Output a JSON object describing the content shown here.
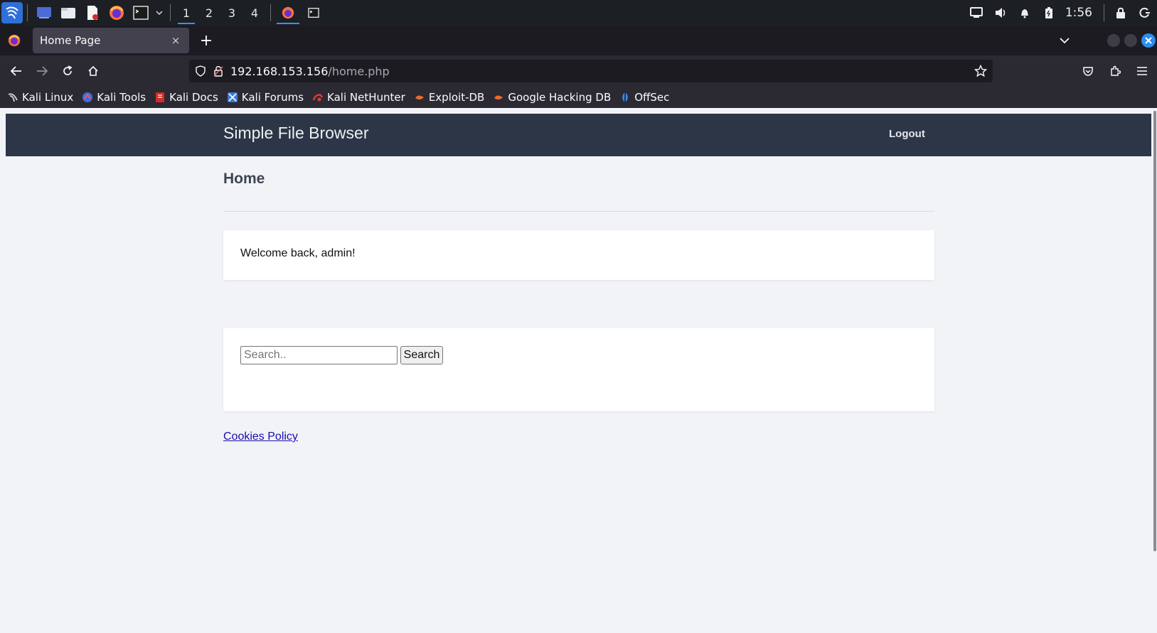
{
  "os_panel": {
    "workspaces": [
      "1",
      "2",
      "3",
      "4"
    ],
    "active_workspace": "1",
    "clock": "1:56",
    "accent": "#3c8ff0"
  },
  "browser": {
    "tab_title": "Home Page",
    "tab_close": "×",
    "new_tab": "+",
    "url_host": "192.168.153.156",
    "url_path": "/home.php",
    "bookmarks": [
      {
        "label": "Kali Linux",
        "icon": "kali-dragon-icon"
      },
      {
        "label": "Kali Tools",
        "icon": "kali-tools-icon"
      },
      {
        "label": "Kali Docs",
        "icon": "kali-docs-icon"
      },
      {
        "label": "Kali Forums",
        "icon": "kali-forums-icon"
      },
      {
        "label": "Kali NetHunter",
        "icon": "nethunter-icon"
      },
      {
        "label": "Exploit-DB",
        "icon": "exploit-db-icon"
      },
      {
        "label": "Google Hacking DB",
        "icon": "ghdb-icon"
      },
      {
        "label": "OffSec",
        "icon": "offsec-icon"
      }
    ]
  },
  "site": {
    "title": "Simple File Browser",
    "logout": "Logout",
    "heading": "Home",
    "welcome": "Welcome back, admin!",
    "search_placeholder": "Search..",
    "search_button": "Search",
    "cookies_link": "Cookies Policy",
    "header_color": "#2c3646",
    "link_color": "#1a0dab"
  }
}
